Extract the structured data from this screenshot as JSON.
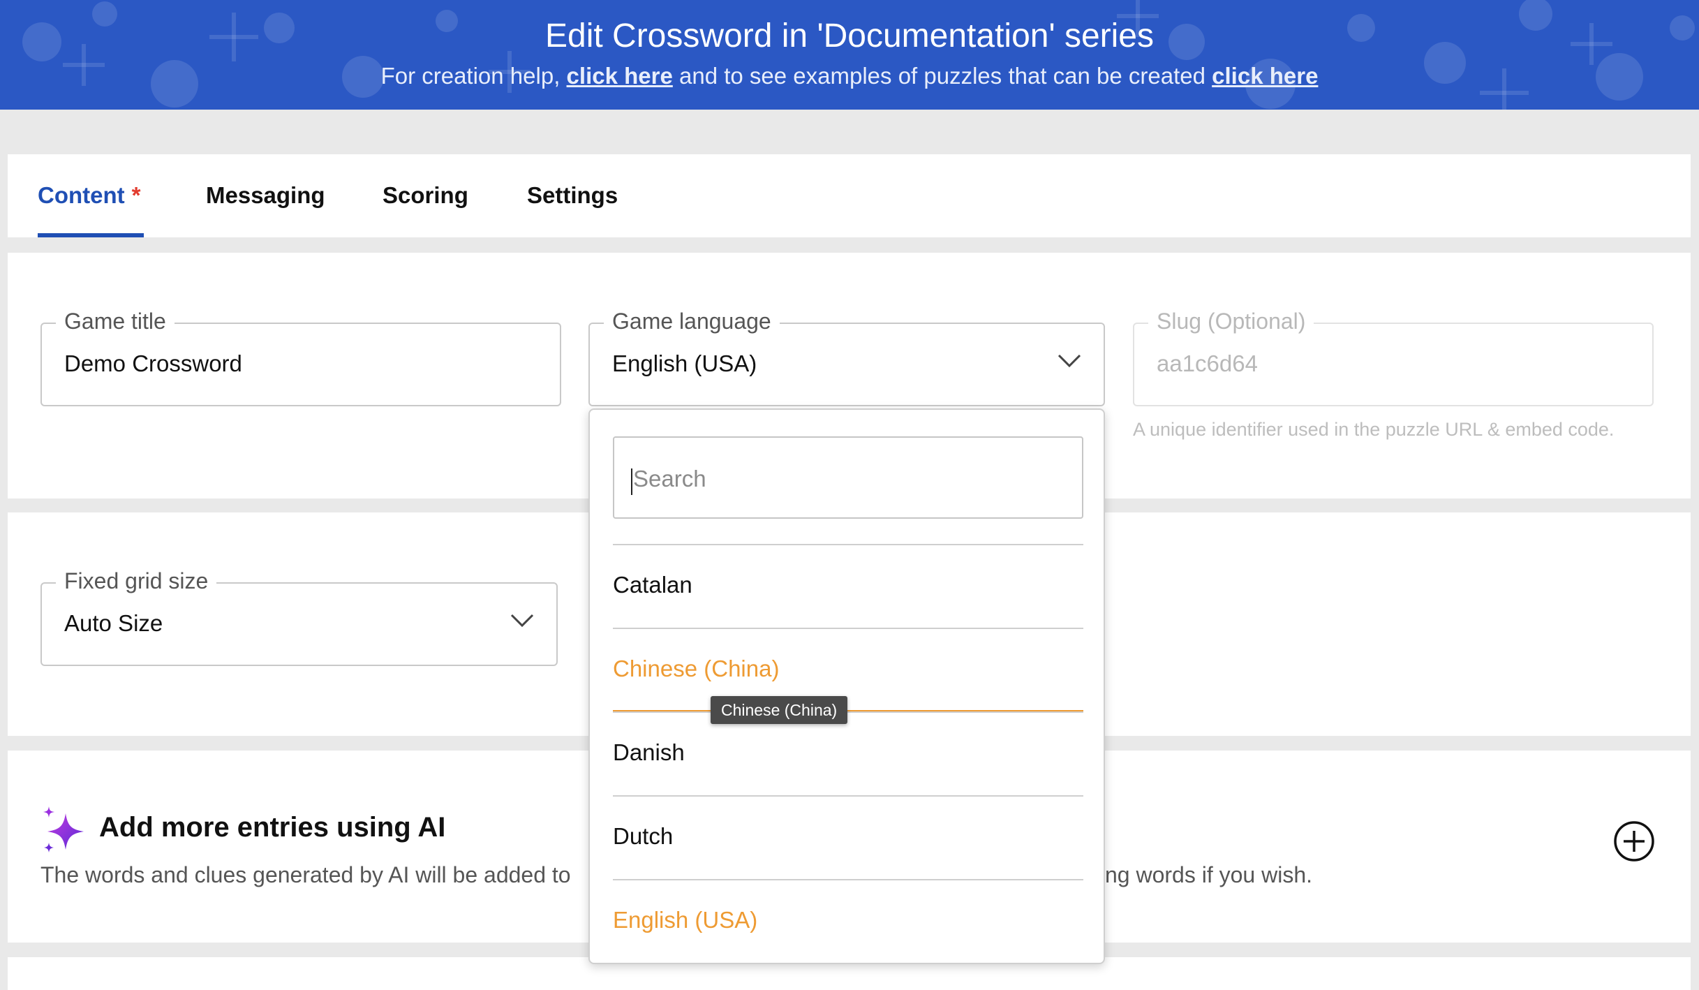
{
  "header": {
    "title": "Edit Crossword in 'Documentation' series",
    "sub_prefix": "For creation help,",
    "sub_link1": "click here",
    "sub_middle": "and to see examples of puzzles that can be created",
    "sub_link2": "click here",
    "bg_color": "#2b58c4"
  },
  "tabs": [
    {
      "label": "Content",
      "required_mark": "*",
      "active": true
    },
    {
      "label": "Messaging"
    },
    {
      "label": "Scoring"
    },
    {
      "label": "Settings"
    }
  ],
  "form": {
    "game_title": {
      "label": "Game title",
      "value": "Demo Crossword"
    },
    "game_language": {
      "label": "Game language",
      "value": "English (USA)"
    },
    "slug": {
      "label": "Slug (Optional)",
      "value": "aa1c6d64",
      "help": "A unique identifier used in the puzzle URL & embed code."
    },
    "grid_size": {
      "label": "Fixed grid size",
      "value": "Auto Size"
    }
  },
  "ai_section": {
    "title": "Add more entries using AI",
    "desc_left": "The words and clues generated by AI will be added to",
    "desc_right": "ng words if you wish."
  },
  "language_dropdown": {
    "search_placeholder": "Search",
    "options": [
      "Catalan",
      "Chinese (China)",
      "Danish",
      "Dutch",
      "English (USA)"
    ],
    "hovered": "Chinese (China)",
    "selected": "English (USA)",
    "tooltip": "Chinese (China)",
    "highlight_color": "#ee9b33"
  },
  "colors": {
    "accent": "#1f4fb4",
    "required": "#e23b2e",
    "ai_icon": "#8e2de2"
  }
}
